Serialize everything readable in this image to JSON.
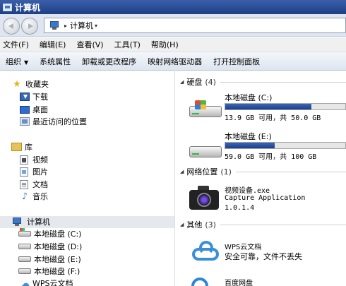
{
  "window": {
    "title": "计算机"
  },
  "address": {
    "crumb": "计算机"
  },
  "menu": [
    "文件(F)",
    "编辑(E)",
    "查看(V)",
    "工具(T)",
    "帮助(H)"
  ],
  "commands": {
    "organize": "组织",
    "items": [
      "系统属性",
      "卸载或更改程序",
      "映射网络驱动器",
      "打开控制面板"
    ]
  },
  "nav": {
    "favorites": {
      "label": "收藏夹",
      "items": [
        "下载",
        "桌面",
        "最近访问的位置"
      ]
    },
    "libraries": {
      "label": "库",
      "items": [
        "视频",
        "图片",
        "文档",
        "音乐"
      ]
    },
    "computer": {
      "label": "计算机",
      "items": [
        "本地磁盘 (C:)",
        "本地磁盘 (D:)",
        "本地磁盘 (E:)",
        "本地磁盘 (F:)",
        "WPS云文档"
      ]
    }
  },
  "groups": {
    "hdd": {
      "label": "硬盘",
      "count": "(4)"
    },
    "network": {
      "label": "网络位置",
      "count": "(1)"
    },
    "other": {
      "label": "其他",
      "count": "(3)"
    }
  },
  "drives": [
    {
      "name": "本地磁盘 (C:)",
      "space": "13.9 GB 可用，共 50.0 GB",
      "used_fraction": 0.72
    },
    {
      "name": "本地磁盘 (E:)",
      "space": "59.0 GB 可用，共 100 GB",
      "used_fraction": 0.41
    }
  ],
  "network_app": {
    "name": "视频设备.exe",
    "desc": "Capture Application",
    "version": "1.0.1.4"
  },
  "others": [
    {
      "name": "WPS云文档",
      "desc": "安全可靠，文件不丢失"
    },
    {
      "name": "百度网盘"
    }
  ],
  "colors": {
    "title_bar": "#1e3f86",
    "bar_fill": "#1c3f8b"
  }
}
